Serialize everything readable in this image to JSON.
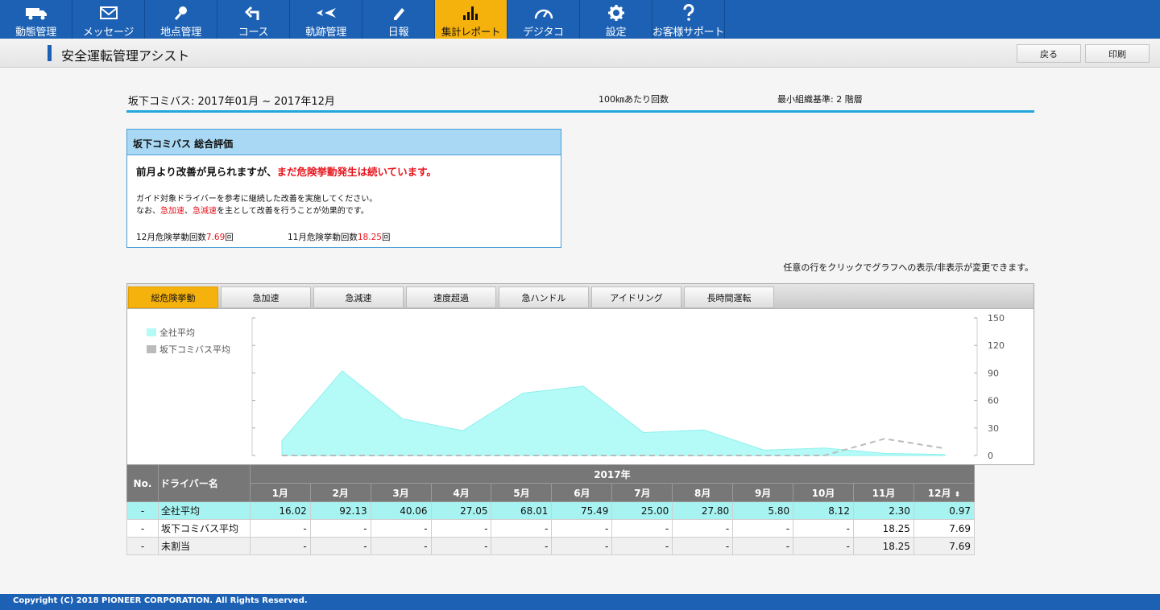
{
  "nav": {
    "items": [
      {
        "label": "動態管理",
        "icon": "truck-icon",
        "active": false
      },
      {
        "label": "メッセージ",
        "icon": "envelope-icon",
        "active": false
      },
      {
        "label": "地点管理",
        "icon": "pin-icon",
        "active": false
      },
      {
        "label": "コース",
        "icon": "route-arrow-icon",
        "active": false
      },
      {
        "label": "軌跡管理",
        "icon": "track-icon",
        "active": false
      },
      {
        "label": "日報",
        "icon": "pencil-icon",
        "active": false
      },
      {
        "label": "集計レポート",
        "icon": "bar-chart-icon",
        "active": true
      },
      {
        "label": "デジタコ",
        "icon": "gauge-icon",
        "active": false
      },
      {
        "label": "設定",
        "icon": "gear-icon",
        "active": false
      },
      {
        "label": "お客様サポート",
        "icon": "question-icon",
        "active": false
      }
    ]
  },
  "subheader": {
    "title": "安全運転管理アシスト",
    "back_label": "戻る",
    "print_label": "印刷"
  },
  "report": {
    "company_period": "坂下コミバス: 2017年01月 ~ 2017年12月",
    "unit": "100㎞あたり回数",
    "level": "最小組織基準: 2 階層"
  },
  "evaluation": {
    "title": "坂下コミバス 総合評価",
    "lead_normal": "前月より改善が見られますが、",
    "lead_red": "まだ危険挙動発生は続いています。",
    "guide1": "ガイド対象ドライバーを参考に継続した改善を実施してください。",
    "guide2_pre": "なお、",
    "guide2_red1": "急加速",
    "guide2_sep": "、",
    "guide2_red2": "急減速",
    "guide2_post": "を主として改善を行うことが効果的です。",
    "current_label": "12月危険挙動回数",
    "current_value": "7.69",
    "prev_label": "11月危険挙動回数",
    "prev_value": "18.25",
    "count_unit": "回"
  },
  "hint": "任意の行をクリックでグラフへの表示/非表示が変更できます。",
  "tabs": [
    {
      "label": "総危険挙動",
      "active": true
    },
    {
      "label": "急加速",
      "active": false
    },
    {
      "label": "急減速",
      "active": false
    },
    {
      "label": "速度超過",
      "active": false
    },
    {
      "label": "急ハンドル",
      "active": false
    },
    {
      "label": "アイドリング",
      "active": false
    },
    {
      "label": "長時間運転",
      "active": false
    }
  ],
  "chart_data": {
    "type": "area",
    "x": [
      "1月",
      "2月",
      "3月",
      "4月",
      "5月",
      "6月",
      "7月",
      "8月",
      "9月",
      "10月",
      "11月",
      "12月"
    ],
    "ylim": [
      0,
      150
    ],
    "yticks": [
      0,
      30,
      60,
      90,
      120,
      150
    ],
    "legend_placement": "top-left",
    "series": [
      {
        "name": "全社平均",
        "style": "area",
        "color": "#b4fbf8",
        "values": [
          16.02,
          92.13,
          40.06,
          27.05,
          68.01,
          75.49,
          25.0,
          27.8,
          5.8,
          8.12,
          2.3,
          0.97
        ]
      },
      {
        "name": "坂下コミバス平均",
        "style": "dashed-line",
        "color": "#bbbbbb",
        "values": [
          0,
          0,
          0,
          0,
          0,
          0,
          0,
          0,
          0,
          0,
          18.25,
          7.69
        ]
      }
    ]
  },
  "table": {
    "no_header": "No.",
    "name_header": "ドライバー名",
    "year_header": "2017年",
    "months": [
      "1月",
      "2月",
      "3月",
      "4月",
      "5月",
      "6月",
      "7月",
      "8月",
      "9月",
      "10月",
      "11月",
      "12月"
    ],
    "sort_glyph": "⬍",
    "rows": [
      {
        "no": "-",
        "name": "全社平均",
        "values": [
          "16.02",
          "92.13",
          "40.06",
          "27.05",
          "68.01",
          "75.49",
          "25.00",
          "27.80",
          "5.80",
          "8.12",
          "2.30",
          "0.97"
        ]
      },
      {
        "no": "-",
        "name": "坂下コミバス平均",
        "values": [
          "-",
          "-",
          "-",
          "-",
          "-",
          "-",
          "-",
          "-",
          "-",
          "-",
          "18.25",
          "7.69"
        ]
      },
      {
        "no": "-",
        "name": "未割当",
        "values": [
          "-",
          "-",
          "-",
          "-",
          "-",
          "-",
          "-",
          "-",
          "-",
          "-",
          "18.25",
          "7.69"
        ]
      }
    ]
  },
  "footer": "Copyright (C) 2018 PIONEER CORPORATION. All Rights Reserved."
}
